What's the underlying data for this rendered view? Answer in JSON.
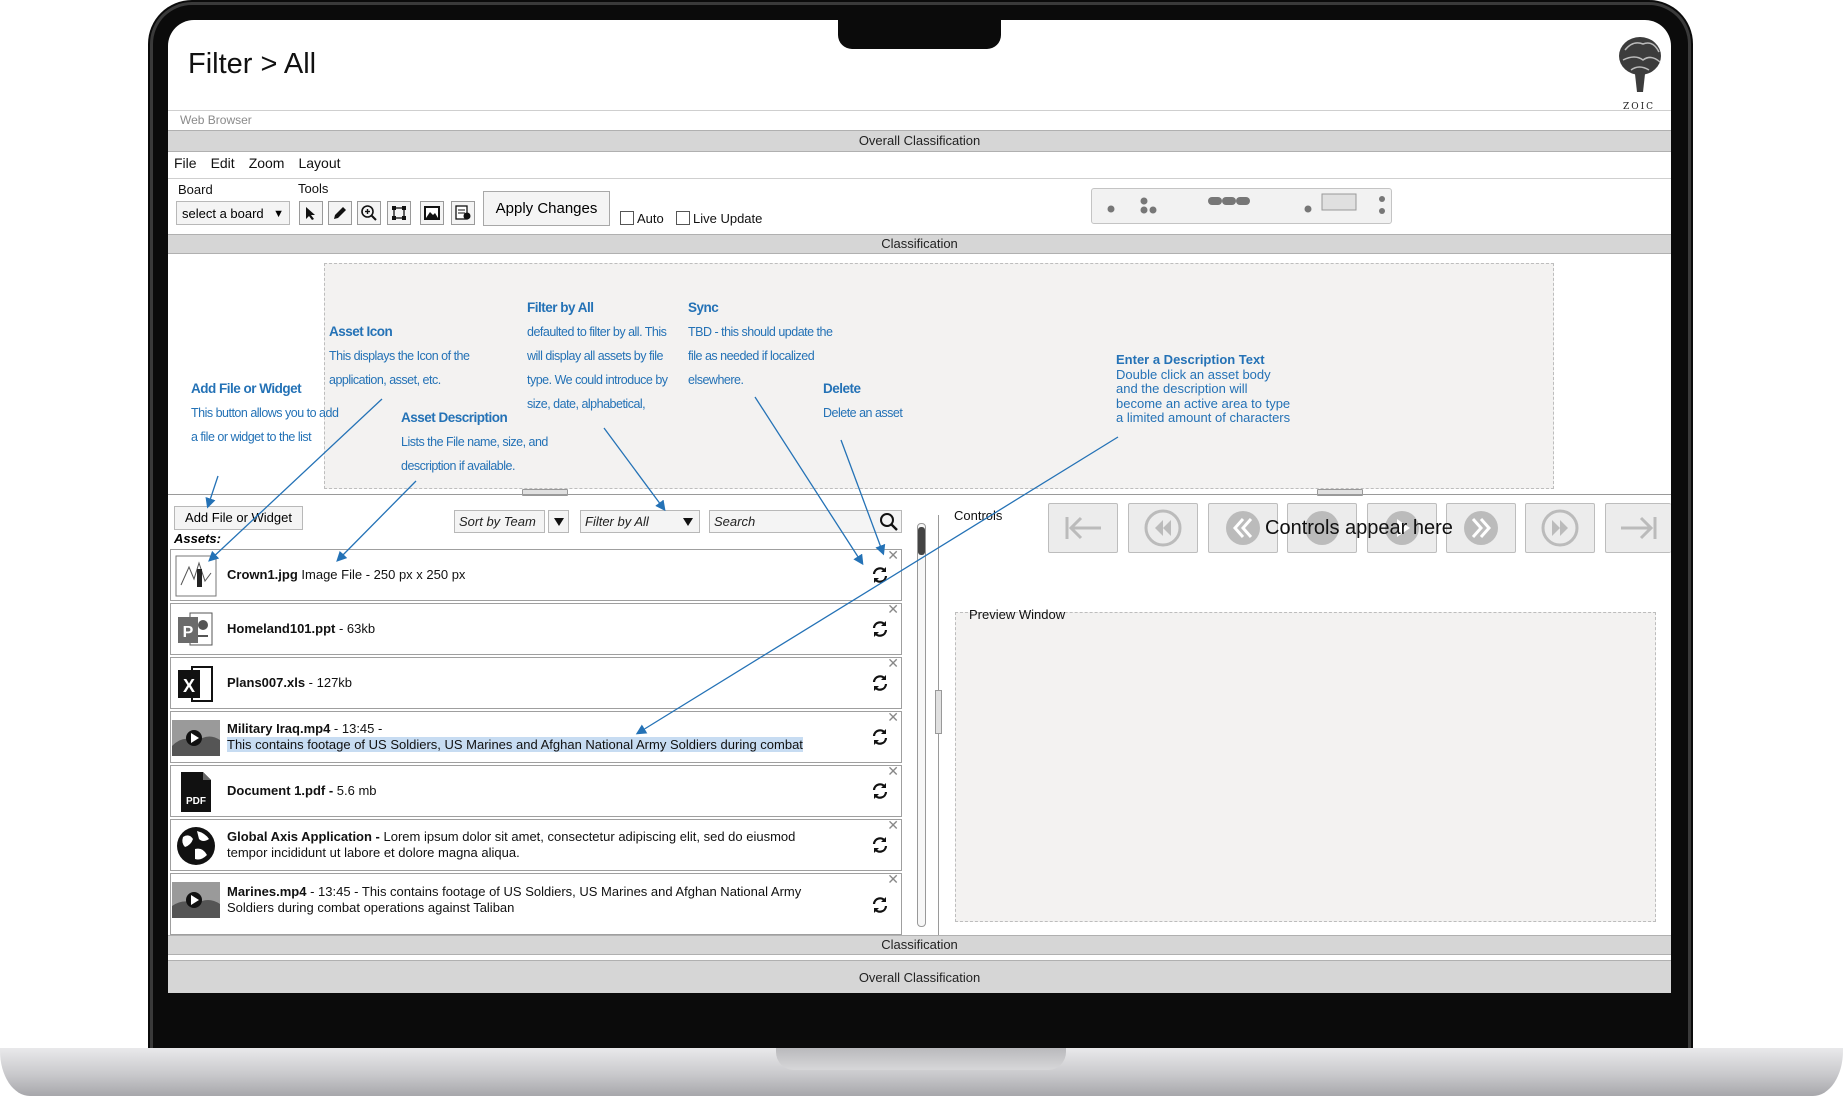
{
  "app": {
    "title": "Filter > All",
    "logo_text": "ZOIC"
  },
  "browser": {
    "label": "Web Browser"
  },
  "classification": {
    "overall": "Overall Classification",
    "section": "Classification"
  },
  "menu": [
    "File",
    "Edit",
    "Zoom",
    "Layout"
  ],
  "toolbar": {
    "board_label": "Board",
    "board_value": "select a board",
    "tools_label": "Tools",
    "tools": [
      "pointer-icon",
      "pencil-icon",
      "zoom-in-icon",
      "crop-icon",
      "image-icon",
      "document-icon"
    ],
    "apply_label": "Apply Changes",
    "auto_label": "Auto",
    "live_update_label": "Live Update"
  },
  "annotations": {
    "add_file": {
      "title": "Add File or Widget",
      "line1": "This button allows you to add",
      "line2": "a file or widget to the list"
    },
    "asset_icon": {
      "title": "Asset Icon",
      "line1": "This displays the Icon of the",
      "line2": "application, asset, etc."
    },
    "asset_description": {
      "title": "Asset Description",
      "line1": "Lists the File name, size, and",
      "line2": "description if available."
    },
    "filter_by_all": {
      "title": "Filter by All",
      "line1": "defaulted to filter by all. This",
      "line2": "will display all assets by file",
      "line3": "type. We could introduce by",
      "line4": "size, date, alphabetical,"
    },
    "sync": {
      "title": "Sync",
      "line1": "TBD - this should update the",
      "line2": "file as needed if localized",
      "line3": "elsewhere."
    },
    "delete": {
      "title": "Delete",
      "line1": "Delete an asset"
    },
    "description_text": {
      "title": "Enter a Description Text",
      "line1": "Double click an asset body",
      "line2": "and the description will",
      "line3": "become an active area to type",
      "line4": "a limited amount of characters"
    }
  },
  "assets_panel": {
    "add_button": "Add  File or Widget",
    "sort_value": "Sort by Team",
    "filter_value": "Filter by All",
    "search_placeholder": "Search",
    "assets_label": "Assets:",
    "items": [
      {
        "name": "Crown1.jpg",
        "detail": "Image File - 250 px x 250 px",
        "icon": "image-thumbnail-icon"
      },
      {
        "name": "Homeland101.ppt",
        "detail": " - 63kb",
        "icon": "powerpoint-icon"
      },
      {
        "name": "Plans007.xls",
        "detail": " - 127kb",
        "icon": "excel-icon"
      },
      {
        "name": "Military Iraq.mp4",
        "detail": "  - 13:45 -",
        "description": "This contains footage of US Soldiers, US Marines and Afghan National Army Soldiers during combat",
        "icon": "video-thumbnail-icon"
      },
      {
        "name": "Document 1.pdf -",
        "detail": " 5.6 mb",
        "icon": "pdf-icon"
      },
      {
        "name": "Global Axis Application -",
        "detail": " Lorem ipsum dolor sit amet, consectetur adipiscing elit, sed do eiusmod",
        "detail2": "tempor incididunt ut labore et dolore magna aliqua.",
        "icon": "globe-icon"
      },
      {
        "name": "Marines.mp4",
        "detail": "  - 13:45 - This contains footage of US Soldiers, US Marines and Afghan National Army",
        "detail2": "Soldiers during combat operations against Taliban",
        "icon": "video-thumbnail-icon"
      }
    ]
  },
  "controls_panel": {
    "label": "Controls",
    "overlay": "Controls appear here",
    "preview_label": "Preview Window"
  }
}
